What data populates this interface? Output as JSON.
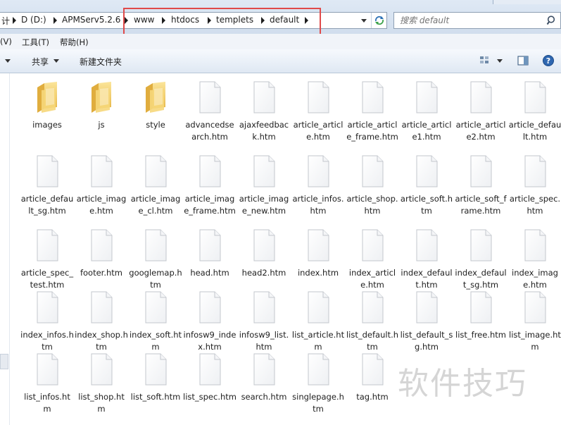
{
  "address_bar": {
    "crumbs": [
      "计",
      "D (D:)",
      "APMServ5.2.6",
      "www",
      "htdocs",
      "templets",
      "default"
    ],
    "search_placeholder": "搜索 default"
  },
  "menu": {
    "items": [
      "(V)",
      "工具(T)",
      "帮助(H)"
    ]
  },
  "toolbar": {
    "share_label": "共享",
    "new_folder_label": "新建文件夹"
  },
  "files": [
    {
      "name": "images",
      "type": "folder"
    },
    {
      "name": "js",
      "type": "folder"
    },
    {
      "name": "style",
      "type": "folder"
    },
    {
      "name": "advancedsearch.htm",
      "type": "file"
    },
    {
      "name": "ajaxfeedback.htm",
      "type": "file"
    },
    {
      "name": "article_article.htm",
      "type": "file"
    },
    {
      "name": "article_article_frame.htm",
      "type": "file"
    },
    {
      "name": "article_article1.htm",
      "type": "file"
    },
    {
      "name": "article_article2.htm",
      "type": "file"
    },
    {
      "name": "article_default.htm",
      "type": "file"
    },
    {
      "name": "article_default_sg.htm",
      "type": "file"
    },
    {
      "name": "article_image.htm",
      "type": "file"
    },
    {
      "name": "article_image_cl.htm",
      "type": "file"
    },
    {
      "name": "article_image_frame.htm",
      "type": "file"
    },
    {
      "name": "article_image_new.htm",
      "type": "file"
    },
    {
      "name": "article_infos.htm",
      "type": "file"
    },
    {
      "name": "article_shop.htm",
      "type": "file"
    },
    {
      "name": "article_soft.htm",
      "type": "file"
    },
    {
      "name": "article_soft_frame.htm",
      "type": "file"
    },
    {
      "name": "article_spec.htm",
      "type": "file"
    },
    {
      "name": "article_spec_test.htm",
      "type": "file"
    },
    {
      "name": "footer.htm",
      "type": "file"
    },
    {
      "name": "googlemap.htm",
      "type": "file"
    },
    {
      "name": "head.htm",
      "type": "file"
    },
    {
      "name": "head2.htm",
      "type": "file"
    },
    {
      "name": "index.htm",
      "type": "file"
    },
    {
      "name": "index_article.htm",
      "type": "file"
    },
    {
      "name": "index_default.htm",
      "type": "file"
    },
    {
      "name": "index_default_sg.htm",
      "type": "file"
    },
    {
      "name": "index_image.htm",
      "type": "file"
    },
    {
      "name": "index_infos.htm",
      "type": "file"
    },
    {
      "name": "index_shop.htm",
      "type": "file"
    },
    {
      "name": "index_soft.htm",
      "type": "file"
    },
    {
      "name": "infosw9_index.htm",
      "type": "file"
    },
    {
      "name": "infosw9_list.htm",
      "type": "file"
    },
    {
      "name": "list_article.htm",
      "type": "file"
    },
    {
      "name": "list_default.htm",
      "type": "file"
    },
    {
      "name": "list_default_sg.htm",
      "type": "file"
    },
    {
      "name": "list_free.htm",
      "type": "file"
    },
    {
      "name": "list_image.htm",
      "type": "file"
    },
    {
      "name": "list_infos.htm",
      "type": "file"
    },
    {
      "name": "list_shop.htm",
      "type": "file"
    },
    {
      "name": "list_soft.htm",
      "type": "file"
    },
    {
      "name": "list_spec.htm",
      "type": "file"
    },
    {
      "name": "search.htm",
      "type": "file"
    },
    {
      "name": "singlepage.htm",
      "type": "file"
    },
    {
      "name": "tag.htm",
      "type": "file"
    }
  ],
  "watermark": "软件技巧",
  "colors": {
    "highlight_box": "#e04a4a",
    "folder_yellow": "#f2cf6a",
    "toolbar_bg": "#dfe8f3"
  }
}
